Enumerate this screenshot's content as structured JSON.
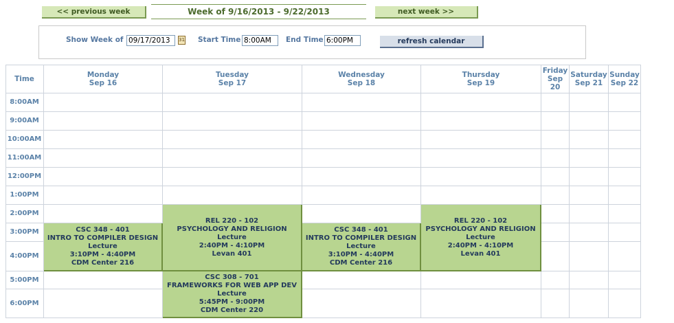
{
  "nav": {
    "prev_label": "<< previous week",
    "next_label": "next week >>",
    "week_title": "Week of 9/16/2013 - 9/22/2013"
  },
  "controls": {
    "show_week_label": "Show Week of",
    "show_week_value": "09/17/2013",
    "calendar_icon_text": "31",
    "start_time_label": "Start Time",
    "start_time_value": "8:00AM",
    "end_time_label": "End Time",
    "end_time_value": "6:00PM",
    "refresh_label": "refresh calendar"
  },
  "calendar": {
    "time_header": "Time",
    "days": [
      {
        "day": "Monday",
        "date": "Sep 16"
      },
      {
        "day": "Tuesday",
        "date": "Sep 17"
      },
      {
        "day": "Wednesday",
        "date": "Sep 18"
      },
      {
        "day": "Thursday",
        "date": "Sep 19"
      },
      {
        "day": "Friday",
        "date_line1": "Sep",
        "date_line2": "20"
      },
      {
        "day": "Saturday",
        "date": "Sep 21"
      },
      {
        "day": "Sunday",
        "date": "Sep 22"
      }
    ],
    "times": [
      "8:00AM",
      "9:00AM",
      "10:00AM",
      "11:00AM",
      "12:00PM",
      "1:00PM",
      "2:00PM",
      "3:00PM",
      "4:00PM",
      "5:00PM",
      "6:00PM"
    ],
    "events": [
      {
        "course": "CSC 348 - 401",
        "title": "INTRO TO COMPILER DESIGN",
        "type": "Lecture",
        "time": "3:10PM - 4:40PM",
        "location": "CDM Center 216"
      },
      {
        "course": "REL 220 - 102",
        "title": "PSYCHOLOGY AND RELIGION",
        "type": "Lecture",
        "time": "2:40PM - 4:10PM",
        "location": "Levan 401"
      },
      {
        "course": "CSC 348 - 401",
        "title": "INTRO TO COMPILER DESIGN",
        "type": "Lecture",
        "time": "3:10PM - 4:40PM",
        "location": "CDM Center 216"
      },
      {
        "course": "REL 220 - 102",
        "title": "PSYCHOLOGY AND RELIGION",
        "type": "Lecture",
        "time": "2:40PM - 4:10PM",
        "location": "Levan 401"
      },
      {
        "course": "CSC 308 - 701",
        "title": "FRAMEWORKS FOR WEB APP DEV",
        "type": "Lecture",
        "time": "5:45PM - 9:00PM",
        "location": "CDM Center 220"
      }
    ],
    "colors": {
      "event_bg": "#b8d590",
      "header_text": "#5b82a8",
      "grid_line": "#cdd3dc"
    }
  }
}
